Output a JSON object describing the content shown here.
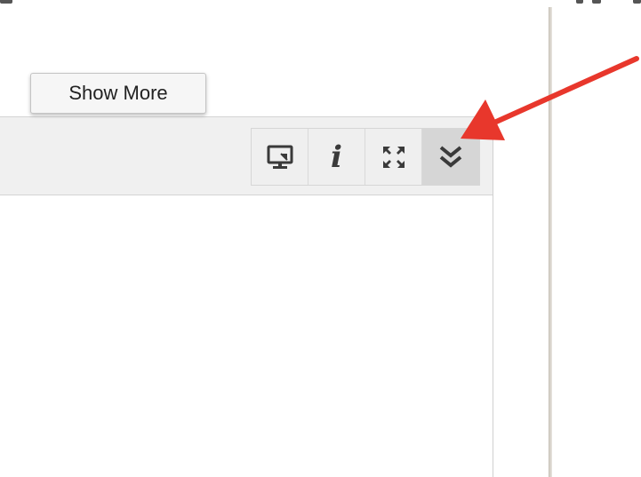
{
  "tooltip": {
    "label": "Show More"
  },
  "toolbar": {
    "buttons": [
      {
        "icon": "monitor-icon"
      },
      {
        "icon": "info-icon",
        "glyph": "i"
      },
      {
        "icon": "expand-icon"
      },
      {
        "icon": "chevron-double-down-icon",
        "active": true
      }
    ]
  },
  "annotation": {
    "color": "#e8372c",
    "icon": "red-arrow-annotation"
  },
  "colors": {
    "header_bg": "#f0f0f0",
    "active_button_bg": "#d6d6d6",
    "icon_color": "#3a3a3a"
  }
}
